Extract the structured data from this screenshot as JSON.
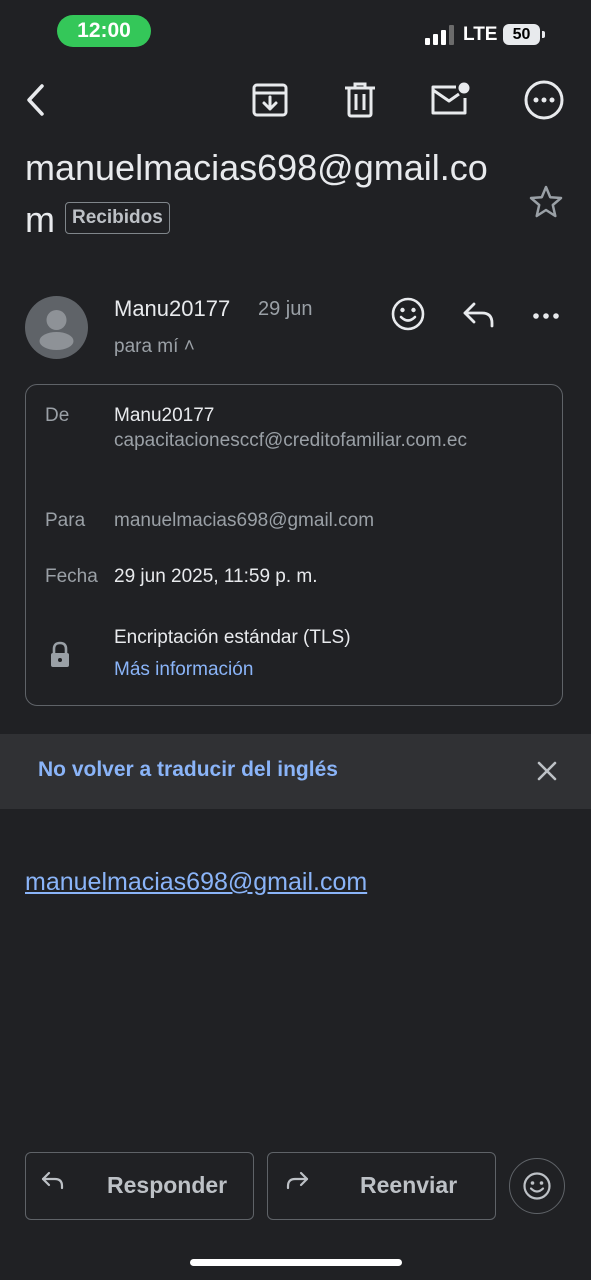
{
  "status_bar": {
    "time": "12:00",
    "network": "LTE",
    "battery": "50"
  },
  "toolbar": {
    "back_icon": "chevron-left-icon",
    "archive_icon": "archive-icon",
    "delete_icon": "trash-icon",
    "mark_unread_icon": "mail-unread-icon",
    "more_icon": "more-circle-icon"
  },
  "subject": {
    "text": "manuelmacias698@gmail.com",
    "label": "Recibidos"
  },
  "sender": {
    "name": "Manu20177",
    "date": "29 jun",
    "to_me": "para mí ˄"
  },
  "details": {
    "from_label": "De",
    "from_name": "Manu20177",
    "from_email": "capacitacionesccf@creditofamiliar.com.ec",
    "to_label": "Para",
    "to_value": "manuelmacias698@gmail.com",
    "date_label": "Fecha",
    "date_value": "29 jun 2025, 11:59 p. m.",
    "encryption": "Encriptación estándar (TLS)",
    "more_info": "Más información"
  },
  "translate": {
    "text": "No volver a traducir del inglés"
  },
  "body": {
    "link": "manuelmacias698@gmail.com"
  },
  "actions": {
    "reply": "Responder",
    "forward": "Reenviar"
  },
  "colors": {
    "background": "#202124",
    "link": "#8ab4f8",
    "pill": "#34c759"
  }
}
